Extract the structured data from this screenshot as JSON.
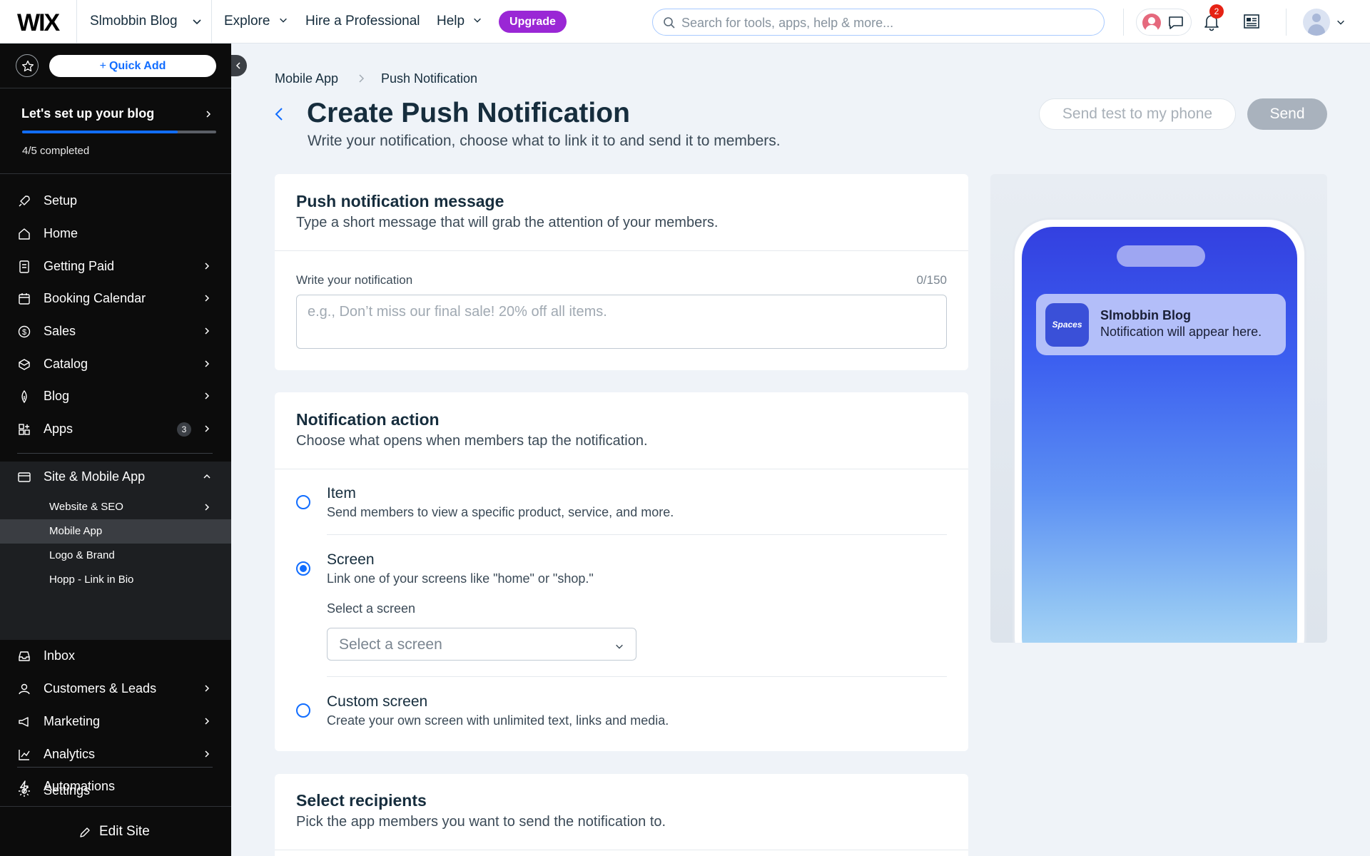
{
  "topbar": {
    "logo": "WIX",
    "site_name": "Slmobbin Blog",
    "nav": [
      "Explore",
      "Hire a Professional",
      "Help"
    ],
    "upgrade": "Upgrade",
    "search_placeholder": "Search for tools, apps, help & more...",
    "notifications_count": "2"
  },
  "sidebar": {
    "quick_add": "Quick Add",
    "setup_title": "Let's set up your blog",
    "progress_text": "4/5 completed",
    "progress_fraction": 0.8,
    "items": [
      {
        "label": "Setup",
        "icon": "rocket-icon"
      },
      {
        "label": "Home",
        "icon": "home-icon"
      },
      {
        "label": "Getting Paid",
        "icon": "payment-icon"
      },
      {
        "label": "Booking Calendar",
        "icon": "calendar-icon"
      },
      {
        "label": "Sales",
        "icon": "dollar-icon"
      },
      {
        "label": "Catalog",
        "icon": "catalog-icon"
      },
      {
        "label": "Blog",
        "icon": "pen-nib-icon"
      },
      {
        "label": "Apps",
        "icon": "apps-icon",
        "badge": "3"
      }
    ],
    "site_mobile_app": "Site & Mobile App",
    "sub_items": [
      "Website & SEO",
      "Mobile App",
      "Logo & Brand",
      "Hopp - Link in Bio"
    ],
    "items2": [
      {
        "label": "Inbox",
        "icon": "inbox-icon"
      },
      {
        "label": "Customers & Leads",
        "icon": "customers-icon"
      },
      {
        "label": "Marketing",
        "icon": "marketing-icon"
      },
      {
        "label": "Analytics",
        "icon": "analytics-icon"
      },
      {
        "label": "Automations",
        "icon": "automation-icon"
      }
    ],
    "settings": "Settings",
    "edit_site": "Edit Site"
  },
  "main": {
    "breadcrumb": [
      "Mobile App",
      "Push Notification"
    ],
    "title": "Create Push Notification",
    "subtitle": "Write your notification, choose what to link it to and send it to members.",
    "send_test": "Send test to my phone",
    "send": "Send",
    "message_card": {
      "title": "Push notification message",
      "subtitle": "Type a short message that will grab the attention of your members.",
      "field_label": "Write your notification",
      "counter": "0/150",
      "placeholder": "e.g., Don’t miss our final sale! 20% off all items."
    },
    "action_card": {
      "title": "Notification action",
      "subtitle": "Choose what opens when members tap the notification.",
      "options": [
        {
          "title": "Item",
          "desc": "Send members to view a specific product, service, and more.",
          "checked": false
        },
        {
          "title": "Screen",
          "desc": "Link one of your screens like \"home\" or \"shop.\"",
          "checked": true
        },
        {
          "title": "Custom screen",
          "desc": "Create your own screen with unlimited text, links and media.",
          "checked": false
        }
      ],
      "select_label": "Select a screen",
      "select_placeholder": "Select a screen"
    },
    "recipients_card": {
      "title": "Select recipients",
      "subtitle": "Pick the app members you want to send the notification to."
    }
  },
  "preview": {
    "app_icon_text": "Spaces",
    "notif_title": "Slmobbin Blog",
    "notif_body": "Notification will appear here."
  },
  "colors": {
    "accent": "#116dff",
    "upgrade": "#9a27d5",
    "sidebar_bg": "#0c0c0c"
  }
}
